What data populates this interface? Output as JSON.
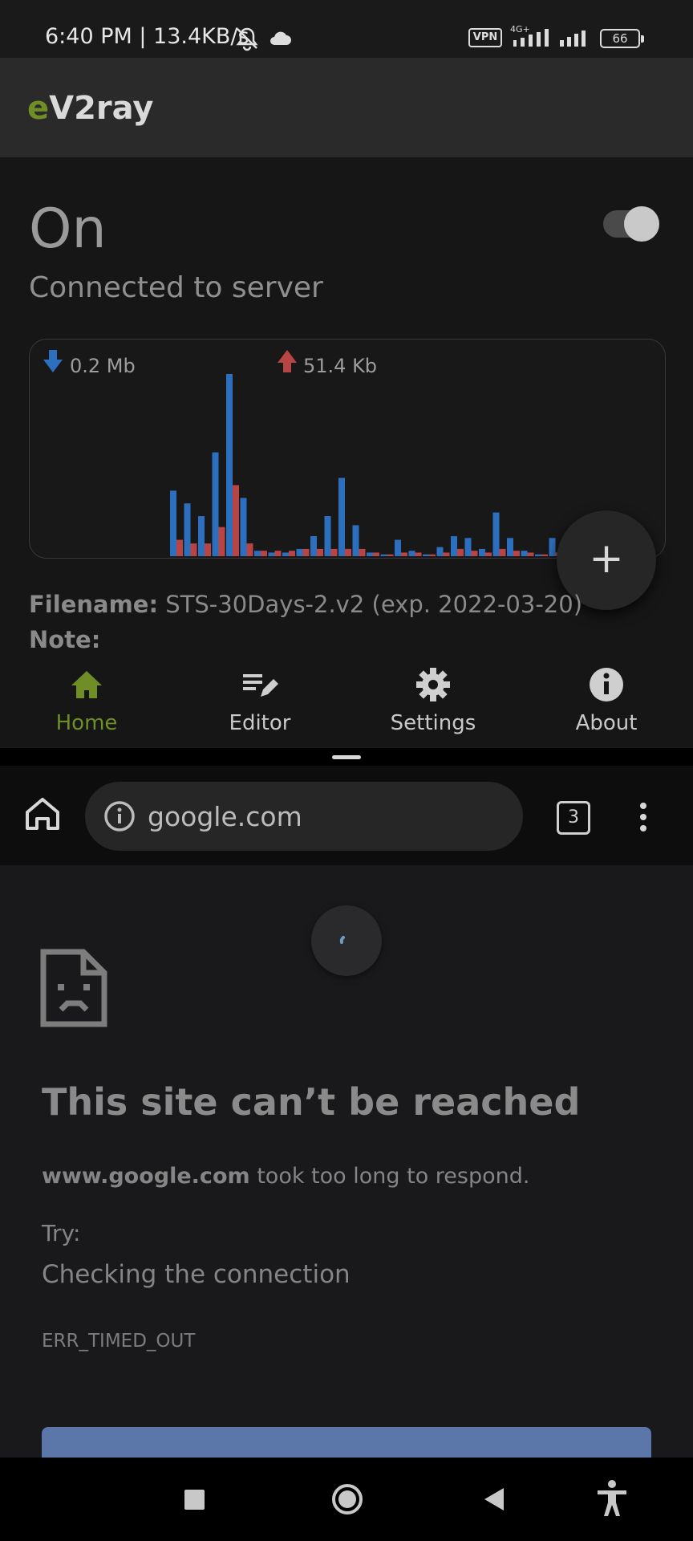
{
  "status_bar": {
    "time_speed": "6:40 PM | 13.4KB/s",
    "vpn_badge": "VPN",
    "network": "4G+",
    "battery": "66"
  },
  "app": {
    "title_accent": "e",
    "title_rest": "V2ray",
    "accent_color": "#6f8e26",
    "state": "On",
    "state_detail": "Connected to server",
    "toggle_on": true,
    "traffic": {
      "download_label": "0.2 Mb",
      "upload_label": "51.4 Kb",
      "download_color": "#2c6fbf",
      "upload_color": "#b84444"
    },
    "fab_label": "+",
    "filename_key": "Filename:",
    "filename_value": "STS-30Days-2.v2 (exp. 2022-03-20)",
    "note_key": "Note:",
    "nav": [
      {
        "label": "Home",
        "icon": "home-icon",
        "active": true
      },
      {
        "label": "Editor",
        "icon": "edit-icon",
        "active": false
      },
      {
        "label": "Settings",
        "icon": "gear-icon",
        "active": false
      },
      {
        "label": "About",
        "icon": "info-icon",
        "active": false
      }
    ]
  },
  "browser": {
    "url": "google.com",
    "tab_count": "3",
    "error_title": "This site can’t be reached",
    "error_domain": "www.google.com",
    "error_message": " took too long to respond.",
    "try_label": "Try:",
    "suggestion": "Checking the connection",
    "error_code": "ERR_TIMED_OUT",
    "button_color": "#5b76a8"
  },
  "chart_data": {
    "type": "bar",
    "title": "",
    "series": [
      {
        "name": "download",
        "values": [
          0.36,
          0.29,
          0.22,
          0.57,
          1.0,
          0.32,
          0.03,
          0.02,
          0.02,
          0.04,
          0.11,
          0.22,
          0.43,
          0.17,
          0.02,
          0.01,
          0.09,
          0.03,
          0.01,
          0.05,
          0.11,
          0.1,
          0.04,
          0.24,
          0.1,
          0.03,
          0.01,
          0.1,
          0.05,
          0.06,
          0.07,
          0.11,
          0.06,
          0.1
        ]
      },
      {
        "name": "upload",
        "values": [
          0.09,
          0.07,
          0.07,
          0.16,
          0.39,
          0.07,
          0.03,
          0.03,
          0.03,
          0.04,
          0.04,
          0.04,
          0.04,
          0.04,
          0.02,
          0.01,
          0.02,
          0.02,
          0.01,
          0.02,
          0.04,
          0.03,
          0.02,
          0.04,
          0.03,
          0.02,
          0.01,
          0.02,
          0.02,
          0.02,
          0.02,
          0.03,
          0.02,
          0.02
        ]
      }
    ]
  }
}
